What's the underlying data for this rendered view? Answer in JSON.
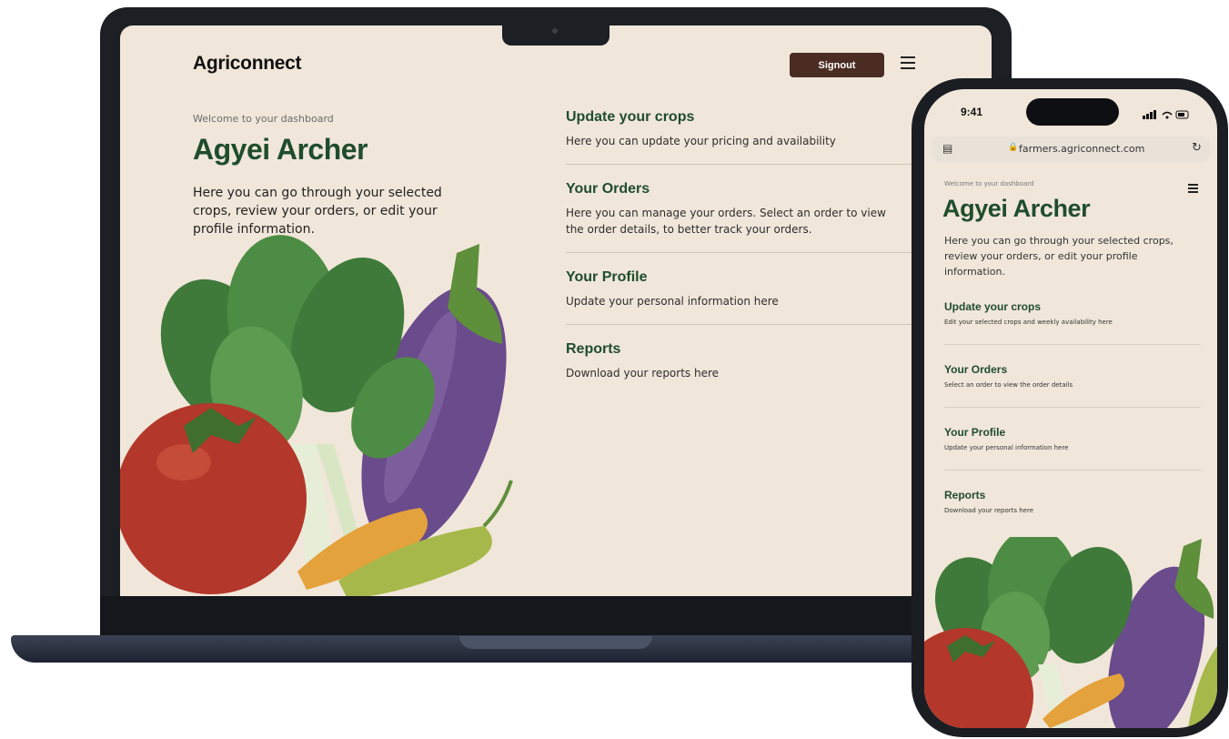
{
  "laptop": {
    "brand": "Agriconnect",
    "signout_label": "Signout",
    "welcome": "Welcome to your dashboard",
    "user_name": "Agyei Archer",
    "intro": "Here you can go through your selected crops,  review your orders, or edit your profile information.",
    "menu": [
      {
        "title": "Update your crops",
        "desc": "Here you can update your pricing and availability"
      },
      {
        "title": "Your Orders",
        "desc": "Here you can manage your orders. Select an order to view the order details, to better track your orders."
      },
      {
        "title": "Your Profile",
        "desc": "Update your personal information here"
      },
      {
        "title": "Reports",
        "desc": "Download your reports here"
      }
    ]
  },
  "phone": {
    "time": "9:41",
    "url": "farmers.agriconnect.com",
    "welcome": "Welcome to your dashboard",
    "user_name": "Agyei Archer",
    "intro": "Here you can go through your selected crops, review your orders, or edit your profile information.",
    "menu": [
      {
        "title": "Update your crops",
        "desc": "Edit your selected crops and weekly availability here"
      },
      {
        "title": "Your Orders",
        "desc": "Select an order to view the order details"
      },
      {
        "title": "Your Profile",
        "desc": "Update your personal information here"
      },
      {
        "title": "Reports",
        "desc": "Download your reports here"
      }
    ]
  },
  "colors": {
    "background": "#f1e6da",
    "brand_green": "#1f4d2c",
    "signout_brown": "#4a2c22",
    "device_frame": "#1c1f24"
  }
}
